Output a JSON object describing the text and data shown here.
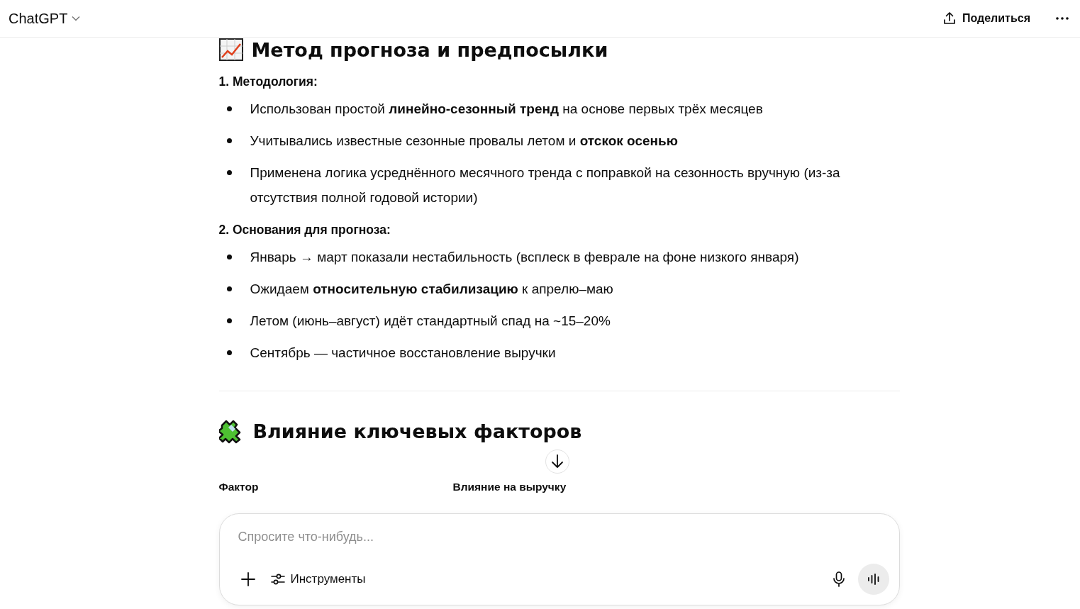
{
  "header": {
    "title": "ChatGPT",
    "share_label": "Поделиться"
  },
  "sections": [
    {
      "kind": "chart",
      "heading": "Метод прогноза и предпосылки",
      "groups": [
        {
          "title": "1. Методология:",
          "bullets": [
            "Использован простой **линейно-сезонный тренд** на основе первых трёх месяцев",
            "Учитывались известные сезонные провалы летом и **отскок осенью**",
            "Применена логика усреднённого месячного тренда с поправкой на сезонность вручную (из-за отсутствия полной годовой истории)"
          ]
        },
        {
          "title": "2. Основания для прогноза:",
          "bullets": [
            "Январь → март показали нестабильность (всплеск в феврале на фоне низкого января)",
            "Ожидаем **относительную стабилизацию** к апрелю–маю",
            "Летом (июнь–август) идёт стандартный спад на ~15–20%",
            "Сентябрь — частичное восстановление выручки"
          ]
        }
      ]
    },
    {
      "kind": "puzzle",
      "heading": "Влияние ключевых факторов",
      "table": {
        "columns": [
          "Фактор",
          "Влияние на выручку"
        ]
      }
    }
  ],
  "composer": {
    "placeholder": "Спросите что-нибудь...",
    "tools_label": "Инструменты"
  }
}
